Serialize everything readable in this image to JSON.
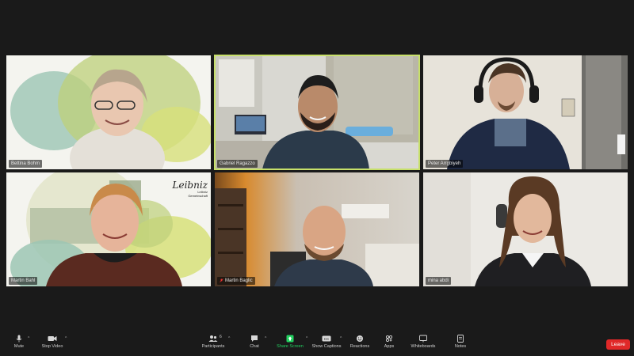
{
  "participants": [
    {
      "name": "Bettina Bohm"
    },
    {
      "name": "Gabriel Ragazzo"
    },
    {
      "name": "Peter Arrgbiyeh"
    },
    {
      "name": "Martin Bahl"
    },
    {
      "name": "Martin Baglic"
    },
    {
      "name": "mina abdi"
    }
  ],
  "logo": {
    "text": "Leibniz",
    "sub1": "Leibniz",
    "sub2": "Gemeinschaft"
  },
  "toolbar": {
    "mute": "Mute",
    "stop_video": "Stop Video",
    "participants": "Participants",
    "participants_count": "6",
    "chat": "Chat",
    "share_screen": "Share Screen",
    "show_captions": "Show Captions",
    "reactions": "Reactions",
    "apps": "Apps",
    "whiteboards": "Whiteboards",
    "notes": "Notes",
    "leave": "Leave"
  },
  "colors": {
    "active_speaker": "#c7e06a",
    "share": "#23d160",
    "leave": "#e02828"
  }
}
